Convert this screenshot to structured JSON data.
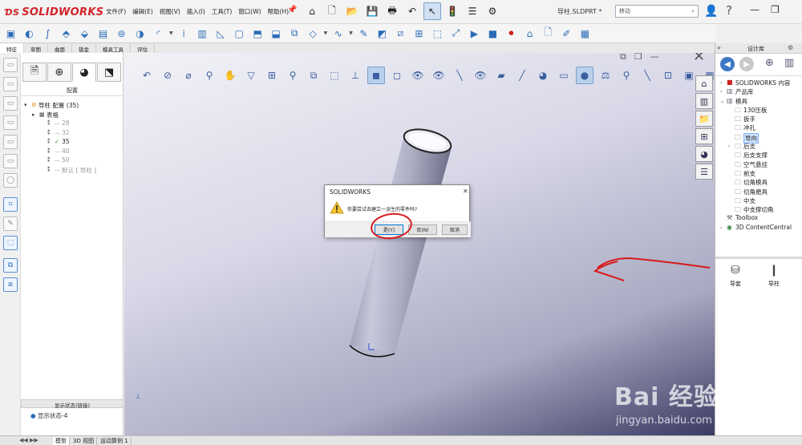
{
  "app": {
    "brand": "SOLIDWORKS",
    "document_title": "导柱.SLDPRT *",
    "search_placeholder": "移动"
  },
  "menu": [
    "文件(F)",
    "编辑(E)",
    "视图(V)",
    "插入(I)",
    "工具(T)",
    "窗口(W)",
    "帮助(H)"
  ],
  "command_tabs": [
    "特征",
    "草图",
    "曲面",
    "钣金",
    "模具工具",
    "评估"
  ],
  "feature_manager": {
    "panel_title": "配置",
    "tree": [
      {
        "label": "导柱 配置  (35)",
        "level": 0,
        "kind": "root"
      },
      {
        "label": "表格",
        "level": 1,
        "kind": "table"
      },
      {
        "label": "28",
        "level": 2,
        "kind": "config",
        "dim": true
      },
      {
        "label": "32",
        "level": 2,
        "kind": "config",
        "dim": true
      },
      {
        "label": "35",
        "level": 2,
        "kind": "config",
        "active": true
      },
      {
        "label": "40",
        "level": 2,
        "kind": "config",
        "dim": true
      },
      {
        "label": "50",
        "level": 2,
        "kind": "config",
        "dim": true
      },
      {
        "label": "默认 [ 导柱 ]",
        "level": 2,
        "kind": "config",
        "dim": true
      }
    ],
    "display_state_header": "显示状态(链接)",
    "display_state_item": "显示状态-4"
  },
  "dialog": {
    "title": "SOLIDWORKS",
    "message": "你要尝试去建立一派生的零件吗?",
    "buttons": {
      "yes": "是(Y)",
      "no": "否(N)",
      "cancel": "取消"
    }
  },
  "design_library": {
    "title": "设计库",
    "tree": [
      {
        "label": "SOLIDWORKS 内容",
        "level": 0,
        "expand": "›",
        "icon": "sw-content-icon"
      },
      {
        "label": "产品库",
        "level": 0,
        "expand": "›",
        "icon": "library-icon"
      },
      {
        "label": "模具",
        "level": 0,
        "expand": "⌄",
        "icon": "library-icon"
      },
      {
        "label": "130压板",
        "level": 1
      },
      {
        "label": "扳手",
        "level": 1
      },
      {
        "label": "冲孔",
        "level": 1
      },
      {
        "label": "导向",
        "level": 1,
        "selected": true
      },
      {
        "label": "后支",
        "level": 1,
        "expand": "›"
      },
      {
        "label": "后支支撑",
        "level": 1
      },
      {
        "label": "空气悬挂",
        "level": 1
      },
      {
        "label": "前支",
        "level": 1
      },
      {
        "label": "切角模具",
        "level": 1
      },
      {
        "label": "切角磨具",
        "level": 1
      },
      {
        "label": "中支",
        "level": 1
      },
      {
        "label": "中支撑切角",
        "level": 1
      },
      {
        "label": "Toolbox",
        "level": 0,
        "icon": "toolbox-icon"
      },
      {
        "label": "3D ContentCentral",
        "level": 0,
        "expand": "›",
        "icon": "3d-content-central-icon"
      }
    ],
    "parts": [
      {
        "label": "导套",
        "icon": "bushing-part-icon"
      },
      {
        "label": "导柱",
        "icon": "guide-pillar-part-icon"
      }
    ]
  },
  "bottom_tabs": [
    "模型",
    "3D 视图",
    "运动算例 1"
  ],
  "watermark": {
    "logo": "Bai 经验",
    "url": "jingyan.baidu.com"
  },
  "colors": {
    "brand_red": "#d1232a",
    "annotation_red": "#d81a1a",
    "selection_blue": "#cfe4ff",
    "ok_green": "#2a9b2a"
  }
}
